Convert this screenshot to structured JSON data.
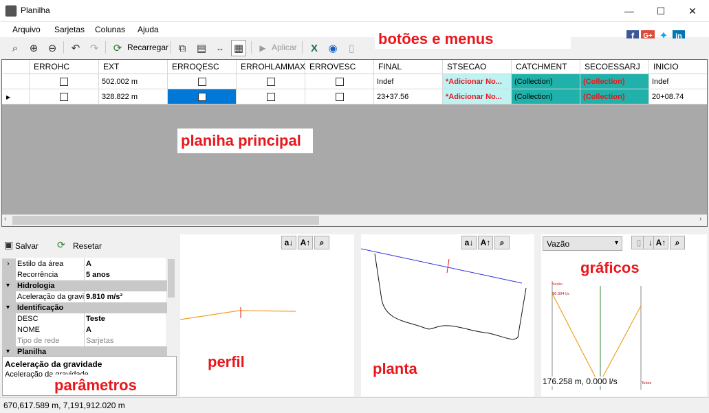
{
  "window": {
    "title": "Planilha",
    "minimize": "—",
    "maximize": "☐",
    "close": "✕"
  },
  "menu": [
    "Arquivo",
    "Sarjetas",
    "Colunas",
    "Ajuda"
  ],
  "toolbar": {
    "reload_label": "Recarregar",
    "apply_label": "Aplicar"
  },
  "annotations": {
    "buttons_menus": "botões e menus",
    "main_sheet": "planiha principal",
    "graphics": "gráficos",
    "profile": "perfil",
    "plan": "planta",
    "parameters": "parâmetros"
  },
  "grid": {
    "columns": [
      "ERROHC",
      "EXT",
      "ERROQESC",
      "ERROHLAMMAX",
      "ERROVESC",
      "FINAL",
      "STSECAO",
      "CATCHMENT",
      "SECOESSARJ",
      "INICIO"
    ],
    "rows": [
      {
        "ext": "502.002 m",
        "final": "Indef",
        "stsecao": "*Adicionar No...",
        "catchment": "(Collection)",
        "secoessarj": "(Collection)",
        "inicio": "Indef"
      },
      {
        "ext": "328.822 m",
        "final": "23+37.56",
        "stsecao": "*Adicionar No...",
        "catchment": "(Collection)",
        "secoessarj": "(Collection)",
        "inicio": "20+08.74"
      }
    ]
  },
  "params": {
    "save_label": "Salvar",
    "reset_label": "Resetar",
    "rows": [
      {
        "type": "prop",
        "name": "Estilo da área",
        "value": "A"
      },
      {
        "type": "prop",
        "name": "Recorrência",
        "value": "5 anos"
      },
      {
        "type": "cat",
        "name": "Hidrologia"
      },
      {
        "type": "prop",
        "name": "Aceleração da gravidade",
        "value": "9.810 m/s²"
      },
      {
        "type": "cat",
        "name": "Identificação"
      },
      {
        "type": "prop",
        "name": "DESC",
        "value": "Teste"
      },
      {
        "type": "prop",
        "name": "NOME",
        "value": "A"
      },
      {
        "type": "prop",
        "name": "Tipo de rede",
        "value": "Sarjetas",
        "muted": true
      },
      {
        "type": "cat",
        "name": "Planilha"
      }
    ],
    "desc_title": "Aceleração da gravidade",
    "desc_text": "Aceleração da gravidade"
  },
  "graph": {
    "select_value": "Vazão",
    "label_top": "Vazão",
    "label_value": "90.304 l/s",
    "label_bottom": "Tubos",
    "readout": "176.258 m, 0.000 l/s"
  },
  "status": {
    "coords": "670,617.589 m, 7,191,912.020 m"
  },
  "colors": {
    "teal": "#20b2aa",
    "select": "#0078d7",
    "red": "#e8171c"
  }
}
